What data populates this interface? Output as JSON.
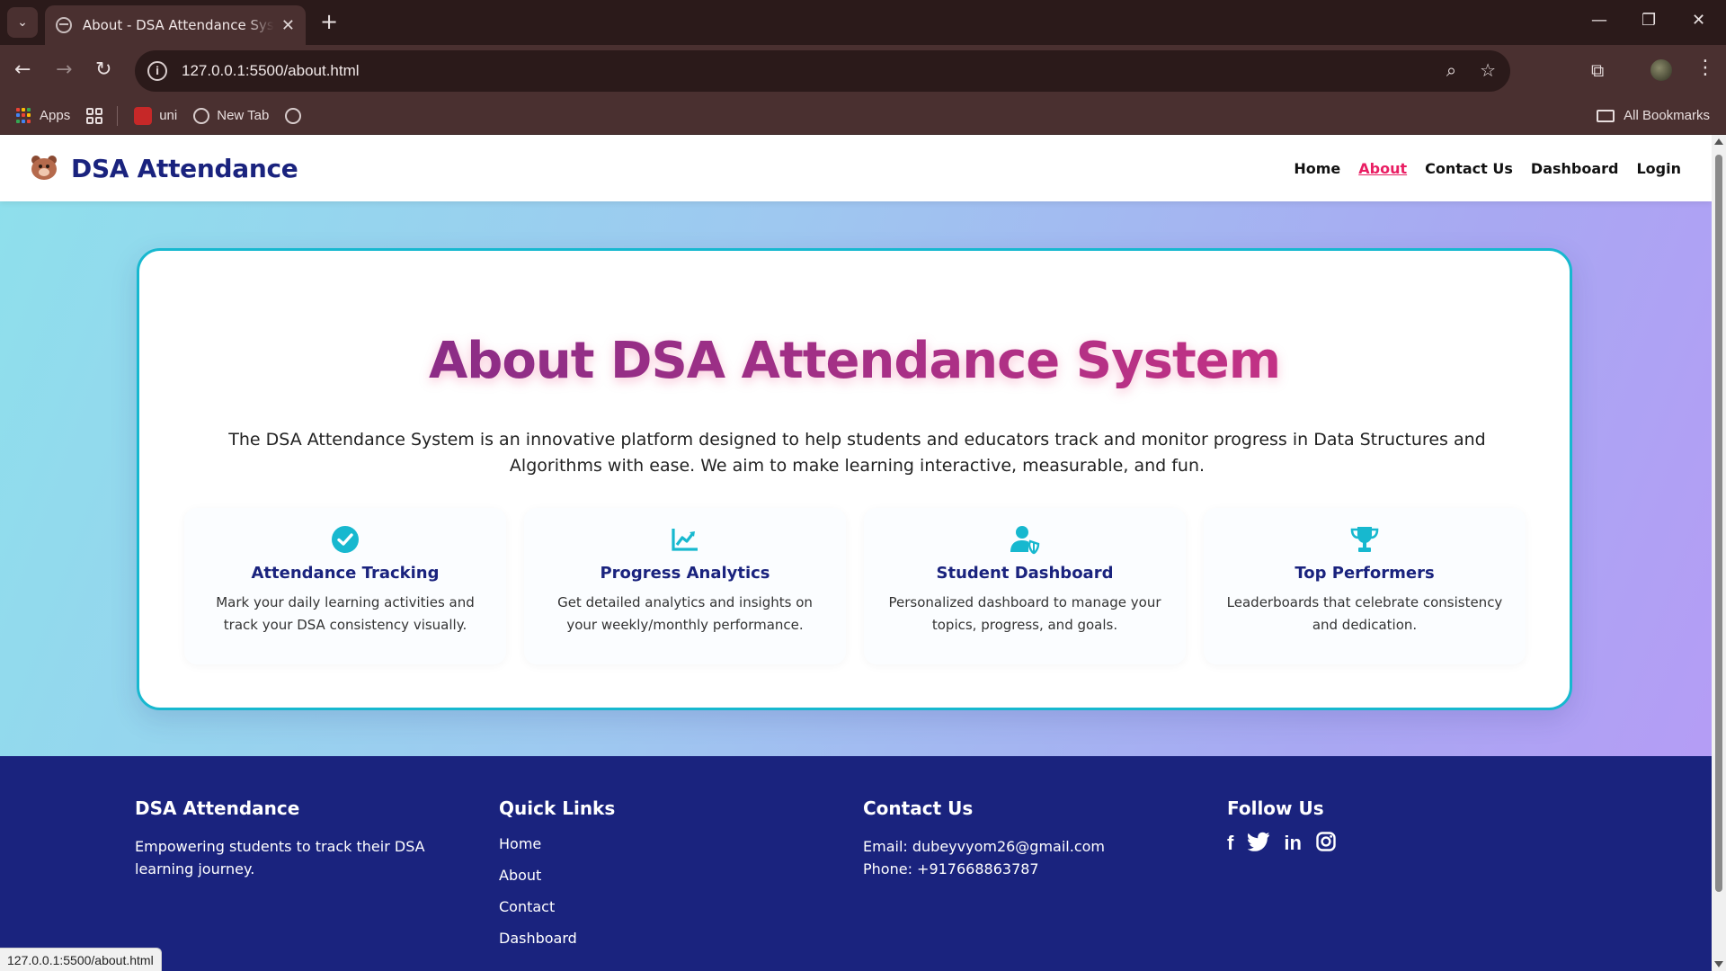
{
  "browser": {
    "tab_title": "About - DSA Attendance System",
    "url": "127.0.0.1:5500/about.html",
    "bookmarks": {
      "apps": "Apps",
      "uni": "uni",
      "new_tab": "New Tab",
      "all_bookmarks": "All Bookmarks"
    },
    "status_url": "127.0.0.1:5500/about.html"
  },
  "header": {
    "brand": "DSA Attendance",
    "nav": [
      "Home",
      "About",
      "Contact Us",
      "Dashboard",
      "Login"
    ],
    "active_nav": "About"
  },
  "about": {
    "title": "About DSA Attendance System",
    "description": "The DSA Attendance System is an innovative platform designed to help students and educators track and monitor progress in Data Structures and Algorithms with ease. We aim to make learning interactive, measurable, and fun.",
    "features": [
      {
        "icon": "check-circle-icon",
        "title": "Attendance Tracking",
        "text": "Mark your daily learning activities and track your DSA consistency visually."
      },
      {
        "icon": "chart-line-icon",
        "title": "Progress Analytics",
        "text": "Get detailed analytics and insights on your weekly/monthly performance."
      },
      {
        "icon": "user-shield-icon",
        "title": "Student Dashboard",
        "text": "Personalized dashboard to manage your topics, progress, and goals."
      },
      {
        "icon": "trophy-icon",
        "title": "Top Performers",
        "text": "Leaderboards that celebrate consistency and dedication."
      }
    ]
  },
  "footer": {
    "brand_title": "DSA Attendance",
    "brand_text": "Empowering students to track their DSA learning journey.",
    "quick_links_title": "Quick Links",
    "quick_links": [
      "Home",
      "About",
      "Contact",
      "Dashboard"
    ],
    "contact_title": "Contact Us",
    "email": "Email: dubeyvyom26@gmail.com",
    "phone": "Phone: +917668863787",
    "follow_title": "Follow Us",
    "social": [
      "facebook-icon",
      "twitter-icon",
      "linkedin-icon",
      "instagram-icon"
    ]
  },
  "colors": {
    "accent": "#17b8cf",
    "brand": "#1a237e",
    "active_link": "#e91e63",
    "title_gradient_start": "#7b2a86",
    "title_gradient_end": "#d63384"
  }
}
